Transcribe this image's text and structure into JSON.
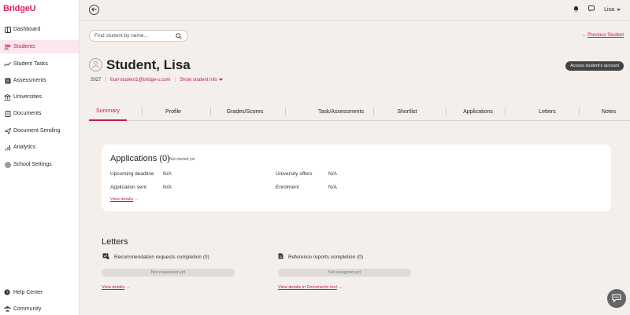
{
  "app": {
    "logo_text": "BridgeU",
    "brand_color": "#d6245c"
  },
  "sidebar": {
    "items": [
      {
        "label": "Dashboard",
        "icon": "dashboard-icon",
        "active": false
      },
      {
        "label": "Students",
        "icon": "students-icon",
        "active": true
      },
      {
        "label": "Student Tasks",
        "icon": "tasks-icon",
        "active": false
      },
      {
        "label": "Assessments",
        "icon": "assessments-icon",
        "active": false
      },
      {
        "label": "Universities",
        "icon": "universities-icon",
        "active": false
      },
      {
        "label": "Documents",
        "icon": "documents-icon",
        "active": false
      },
      {
        "label": "Document Sending",
        "icon": "send-icon",
        "active": false
      },
      {
        "label": "Analytics",
        "icon": "analytics-icon",
        "active": false
      },
      {
        "label": "School Settings",
        "icon": "settings-icon",
        "active": false
      }
    ],
    "bottom": [
      {
        "label": "Help Center",
        "icon": "help-icon"
      },
      {
        "label": "Community",
        "icon": "community-icon"
      }
    ]
  },
  "topbar": {
    "user_name": "Lisa"
  },
  "search": {
    "placeholder": "Find student by name..."
  },
  "previous_student": "Previous Student",
  "student": {
    "name": "Student, Lisa",
    "year": "2027",
    "email": "lisa+student1@bridge-u.com",
    "show_info": "Show student info"
  },
  "access_button": "Access student's account",
  "tabs": [
    "Summary",
    "Profile",
    "Grades/Scores",
    "Task/Assessments",
    "Shortlist",
    "Applications",
    "Letters",
    "Notes"
  ],
  "applications": {
    "title": "Applications",
    "count": "(0)",
    "status": "Not started yet",
    "rows": [
      {
        "label": "Upcoming deadline",
        "value": "N/A"
      },
      {
        "label": "Application sent",
        "value": "N/A"
      },
      {
        "label": "University offers",
        "value": "N/A"
      },
      {
        "label": "Enrolment",
        "value": "N/A"
      }
    ],
    "view_details": "View details"
  },
  "letters": {
    "title": "Letters",
    "recommendation": {
      "label": "Recommendation requests completion (0)",
      "status": "Not requested yet",
      "link": "View details"
    },
    "reference": {
      "label": "Reference reports completion (0)",
      "status": "Not assigned yet",
      "link": "View details in Documents tool"
    }
  }
}
